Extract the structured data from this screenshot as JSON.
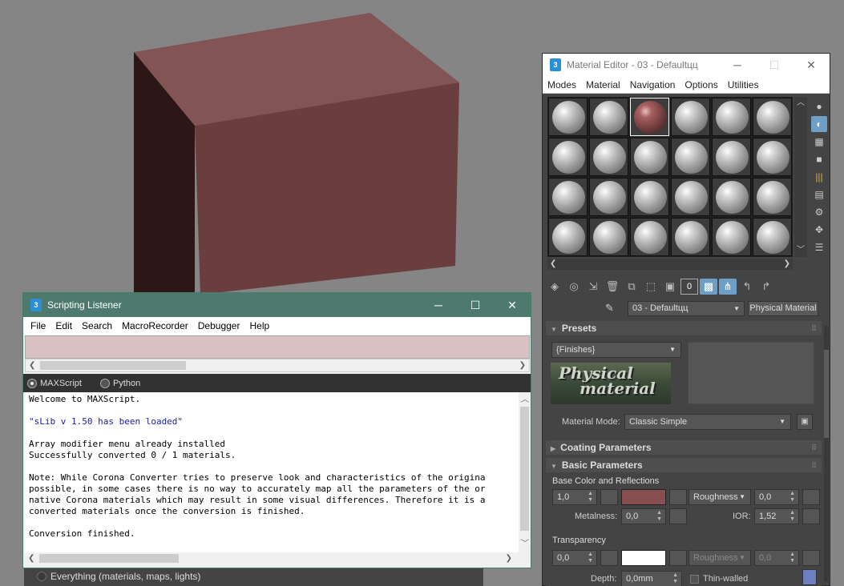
{
  "colors": {
    "viewport_bg": "#858585",
    "cube_front": "#6a3d3f",
    "cube_top": "#835456",
    "cube_side": "#2c1616",
    "listener_title": "#4d7a6d",
    "macro_pane": "#d9c0c3",
    "base_color_swatch": "#874f50",
    "transparency_swatch": "#ffffff"
  },
  "behind_dialog": {
    "label": "Everything (materials, maps, lights)"
  },
  "listener": {
    "title": "Scripting Listener",
    "logo": "3",
    "menu": [
      "File",
      "Edit",
      "Search",
      "MacroRecorder",
      "Debugger",
      "Help"
    ],
    "languages": [
      "MAXScript",
      "Python"
    ],
    "selected_language": "MAXScript",
    "output_lines": [
      {
        "text": "Welcome to MAXScript.",
        "style": "normal"
      },
      {
        "text": "",
        "style": "normal"
      },
      {
        "text": "\"sLib v 1.50 has been loaded\"",
        "style": "blue"
      },
      {
        "text": "",
        "style": "normal"
      },
      {
        "text": "Array modifier menu already installed",
        "style": "normal"
      },
      {
        "text": "Successfully converted 0 / 1 materials.",
        "style": "normal"
      },
      {
        "text": "",
        "style": "normal"
      },
      {
        "text": "Note: While Corona Converter tries to preserve look and characteristics of the origina",
        "style": "normal"
      },
      {
        "text": "possible, in some cases there is no way to accurately map all the parameters of the or",
        "style": "normal"
      },
      {
        "text": "native Corona materials which may result in some visual differences. Therefore it is a",
        "style": "normal"
      },
      {
        "text": "converted materials once the conversion is finished.",
        "style": "normal"
      },
      {
        "text": "",
        "style": "normal"
      },
      {
        "text": "Conversion finished.",
        "style": "normal"
      }
    ]
  },
  "material_editor": {
    "title": "Material Editor - 03 - Defaultцц",
    "logo": "3",
    "menu": [
      "Modes",
      "Material",
      "Navigation",
      "Options",
      "Utilities"
    ],
    "slot_rows": 4,
    "slot_cols": 6,
    "selected_slot": 2,
    "material_name": "03 - Defaultцц",
    "material_type": "Physical Material",
    "presets": {
      "header": "Presets",
      "dropdown_value": "{Finishes}",
      "logo_text_1": "Physical",
      "logo_text_2": "material",
      "mode_label": "Material Mode:",
      "mode_value": "Classic Simple"
    },
    "coating": {
      "header": "Coating Parameters"
    },
    "basic": {
      "header": "Basic Parameters",
      "base_group": "Base Color and Reflections",
      "base_weight": "1,0",
      "roughness_mode": "Roughness",
      "roughness_value": "0,0",
      "metalness_label": "Metalness:",
      "metalness_value": "0,0",
      "ior_label": "IOR:",
      "ior_value": "1,52",
      "transparency_group": "Transparency",
      "transparency_weight": "0,0",
      "trans_roughness_mode": "Roughness",
      "trans_roughness_value": "0,0",
      "depth_label": "Depth:",
      "depth_value": "0,0mm",
      "thin_walled_label": "Thin-walled"
    }
  }
}
